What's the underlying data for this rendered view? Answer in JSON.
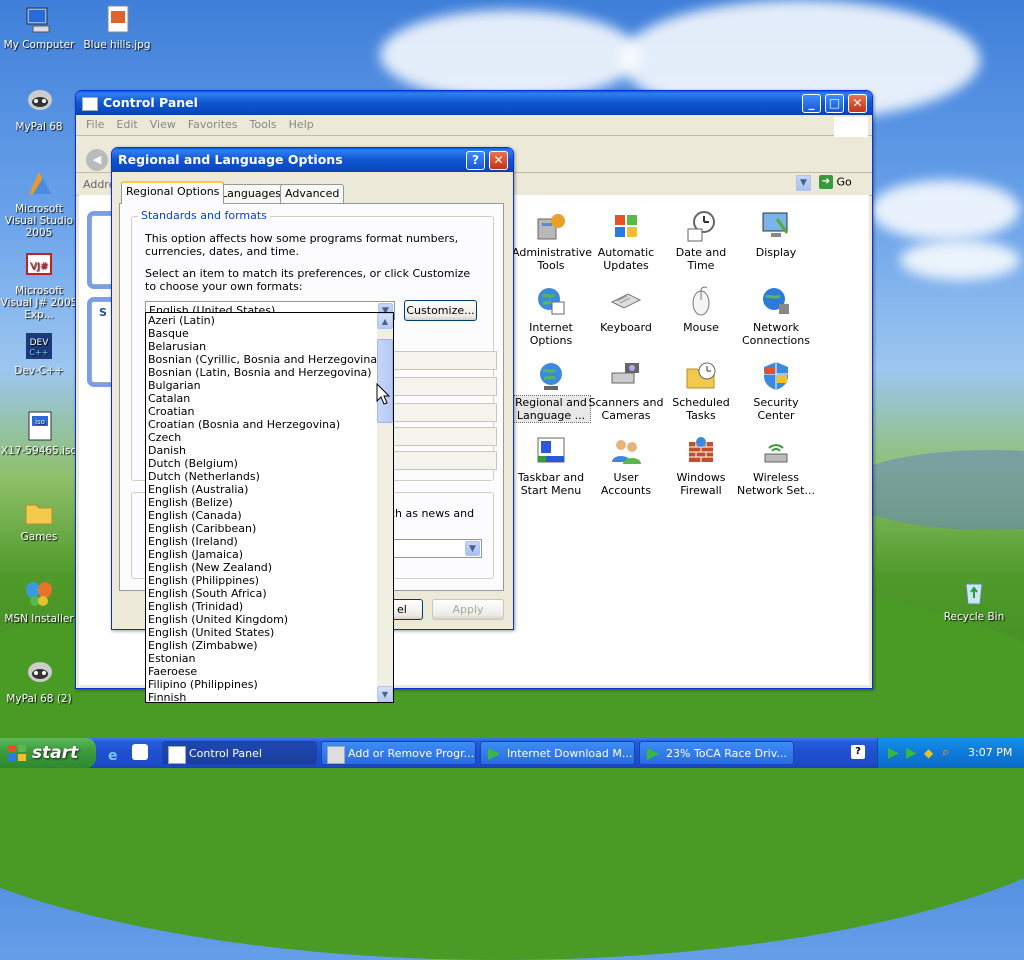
{
  "desktop": {
    "icons": [
      {
        "label": "My Computer"
      },
      {
        "label": "Blue hills.jpg"
      },
      {
        "label": "MyPal 68"
      },
      {
        "label": "Microsoft Visual Studio 2005"
      },
      {
        "label": "Microsoft Visual J# 2005 Exp..."
      },
      {
        "label": "Dev-C++"
      },
      {
        "label": "X17-59465.iso"
      },
      {
        "label": "Games"
      },
      {
        "label": "MSN Installer"
      },
      {
        "label": "MyPal 68 (2)"
      },
      {
        "label": "Recycle Bin"
      }
    ]
  },
  "control_panel": {
    "title": "Control Panel",
    "menu": [
      "File",
      "Edit",
      "View",
      "Favorites",
      "Tools",
      "Help"
    ],
    "address_label": "Addre",
    "go_label": "Go",
    "items": [
      {
        "label": "Administrative Tools"
      },
      {
        "label": "Automatic Updates"
      },
      {
        "label": "Date and Time"
      },
      {
        "label": "Display"
      },
      {
        "label": "Internet Options"
      },
      {
        "label": "Keyboard"
      },
      {
        "label": "Mouse"
      },
      {
        "label": "Network Connections"
      },
      {
        "label": "Regional and Language ..."
      },
      {
        "label": "Scanners and Cameras"
      },
      {
        "label": "Scheduled Tasks"
      },
      {
        "label": "Security Center"
      },
      {
        "label": "Taskbar and Start Menu"
      },
      {
        "label": "User Accounts"
      },
      {
        "label": "Windows Firewall"
      },
      {
        "label": "Wireless Network Set..."
      }
    ],
    "left_s": "S"
  },
  "dialog": {
    "title": "Regional and Language Options",
    "help_glyph": "?",
    "close_glyph": "✕",
    "tabs": [
      "Regional Options",
      "Languages",
      "Advanced"
    ],
    "group_label": "Standards and formats",
    "description": "This option affects how some programs format numbers, currencies, dates, and time.",
    "instruction": "Select an item to match its preferences, or click Customize to choose your own formats:",
    "selected_format": "English (United States)",
    "customize_label": "Customize...",
    "location_partial": "uch as news and",
    "cancel_partial": "el",
    "apply_label": "Apply"
  },
  "dropdown_list": [
    "Azeri (Latin)",
    "Basque",
    "Belarusian",
    "Bosnian (Cyrillic, Bosnia and Herzegovina)",
    "Bosnian (Latin, Bosnia and Herzegovina)",
    "Bulgarian",
    "Catalan",
    "Croatian",
    "Croatian (Bosnia and Herzegovina)",
    "Czech",
    "Danish",
    "Dutch (Belgium)",
    "Dutch (Netherlands)",
    "English (Australia)",
    "English (Belize)",
    "English (Canada)",
    "English (Caribbean)",
    "English (Ireland)",
    "English (Jamaica)",
    "English (New Zealand)",
    "English (Philippines)",
    "English (South Africa)",
    "English (Trinidad)",
    "English (United Kingdom)",
    "English (United States)",
    "English (Zimbabwe)",
    "Estonian",
    "Faeroese",
    "Filipino (Philippines)",
    "Finnish"
  ],
  "taskbar": {
    "start_label": "start",
    "tasks": [
      {
        "label": "Control Panel"
      },
      {
        "label": "Add or Remove Progr..."
      },
      {
        "label": "Internet Download M..."
      },
      {
        "label": "23% ToCA Race Driv..."
      }
    ],
    "help_glyph": "?",
    "clock": "3:07 PM"
  },
  "colors": {
    "titlebar": "#0a5bd8",
    "taskbar": "#245edb",
    "start": "#3c9a3c",
    "tray": "#0f79d8"
  }
}
